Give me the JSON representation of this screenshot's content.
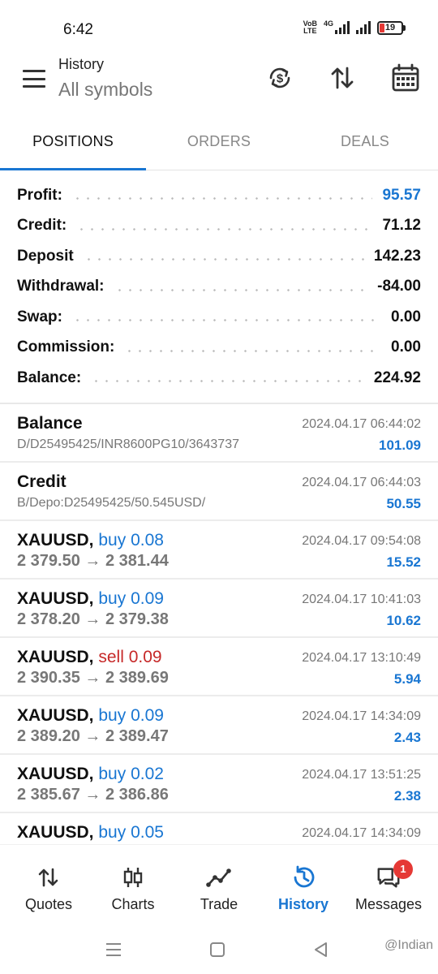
{
  "status_bar": {
    "time": "6:42",
    "network_label_top": "VoB",
    "network_label_bottom": "LTE",
    "network_type": "4G",
    "battery": "19"
  },
  "header": {
    "title": "History",
    "subtitle": "All symbols",
    "icons": [
      "menu-icon",
      "currency-exchange-icon",
      "sort-icon",
      "calendar-icon"
    ]
  },
  "tabs": [
    {
      "label": "POSITIONS",
      "active": true
    },
    {
      "label": "ORDERS",
      "active": false
    },
    {
      "label": "DEALS",
      "active": false
    }
  ],
  "summary": [
    {
      "label": "Profit:",
      "value": "95.57",
      "highlight": true
    },
    {
      "label": "Credit:",
      "value": "71.12"
    },
    {
      "label": "Deposit",
      "value": "142.23"
    },
    {
      "label": "Withdrawal:",
      "value": "-84.00"
    },
    {
      "label": "Swap:",
      "value": "0.00"
    },
    {
      "label": "Commission:",
      "value": "0.00"
    },
    {
      "label": "Balance:",
      "value": "224.92"
    }
  ],
  "deals": [
    {
      "symbol": "Balance",
      "direction": "",
      "volume": "",
      "sub": "D/D25495425/INR8600PG10/3643737",
      "time": "2024.04.17 06:44:02",
      "profit": "101.09"
    },
    {
      "symbol": "Credit",
      "direction": "",
      "volume": "",
      "sub": "B/Depo:D25495425/50.545USD/",
      "time": "2024.04.17 06:44:03",
      "profit": "50.55"
    },
    {
      "symbol": "XAUUSD,",
      "direction": "buy",
      "volume": "0.08",
      "open": "2 379.50",
      "close": "2 381.44",
      "time": "2024.04.17 09:54:08",
      "profit": "15.52"
    },
    {
      "symbol": "XAUUSD,",
      "direction": "buy",
      "volume": "0.09",
      "open": "2 378.20",
      "close": "2 379.38",
      "time": "2024.04.17 10:41:03",
      "profit": "10.62"
    },
    {
      "symbol": "XAUUSD,",
      "direction": "sell",
      "volume": "0.09",
      "open": "2 390.35",
      "close": "2 389.69",
      "time": "2024.04.17 13:10:49",
      "profit": "5.94"
    },
    {
      "symbol": "XAUUSD,",
      "direction": "buy",
      "volume": "0.09",
      "open": "2 389.20",
      "close": "2 389.47",
      "time": "2024.04.17 14:34:09",
      "profit": "2.43"
    },
    {
      "symbol": "XAUUSD,",
      "direction": "buy",
      "volume": "0.02",
      "open": "2 385.67",
      "close": "2 386.86",
      "time": "2024.04.17 13:51:25",
      "profit": "2.38"
    },
    {
      "symbol": "XAUUSD,",
      "direction": "buy",
      "volume": "0.05",
      "open": "",
      "close": "",
      "time": "2024.04.17 14:34:09",
      "profit": ""
    }
  ],
  "arrow": "→",
  "bottom_nav": [
    {
      "label": "Quotes",
      "icon": "quotes-icon",
      "active": false
    },
    {
      "label": "Charts",
      "icon": "candlestick-icon",
      "active": false
    },
    {
      "label": "Trade",
      "icon": "trade-line-icon",
      "active": false
    },
    {
      "label": "History",
      "icon": "history-icon",
      "active": true
    },
    {
      "label": "Messages",
      "icon": "messages-icon",
      "active": false,
      "badge": "1"
    }
  ],
  "watermark": "@Indian",
  "colors": {
    "accent": "#1976d2",
    "sell": "#c62828",
    "badge": "#e53935"
  }
}
